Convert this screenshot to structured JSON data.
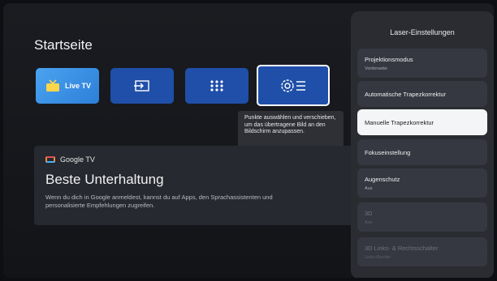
{
  "home": {
    "title": "Startseite",
    "tiles": [
      {
        "label": "Live TV",
        "icon": "tv-icon"
      },
      {
        "icon": "input-icon"
      },
      {
        "icon": "apps-grid-icon"
      },
      {
        "icon": "settings-icon"
      }
    ],
    "tooltip": "Punkte auswählen und verschieben, um das übertragene Bild an den Bildschirm anzupassen."
  },
  "google_tv_card": {
    "brand": "Google TV",
    "headline": "Beste Unterhaltung",
    "body": "Wenn du dich in Google anmeldest, kannst du auf Apps, den Sprachassistenten und personalisierte Empfehlungen zugreifen."
  },
  "panel": {
    "title": "Laser-Einstellungen",
    "items": [
      {
        "label": "Projektionsmodus",
        "value": "Vorderseite",
        "state": "normal"
      },
      {
        "label": "Automatische Trapezkorrektur",
        "state": "normal"
      },
      {
        "label": "Manuelle Trapezkorrektur",
        "state": "selected"
      },
      {
        "label": "Fokuseinstellung",
        "state": "normal"
      },
      {
        "label": "Augenschutz",
        "value": "Aus",
        "state": "normal"
      },
      {
        "label": "3D",
        "value": "Aus",
        "state": "disabled"
      },
      {
        "label": "3D Links- & Rechtsschalter",
        "value": "Links-Rechts",
        "state": "disabled"
      }
    ]
  },
  "colors": {
    "tile_blue": "#1f4fa8",
    "live_tv_blue": "#3b93e8",
    "panel_bg": "#2a2c31",
    "selected_bg": "#f4f5f7"
  }
}
